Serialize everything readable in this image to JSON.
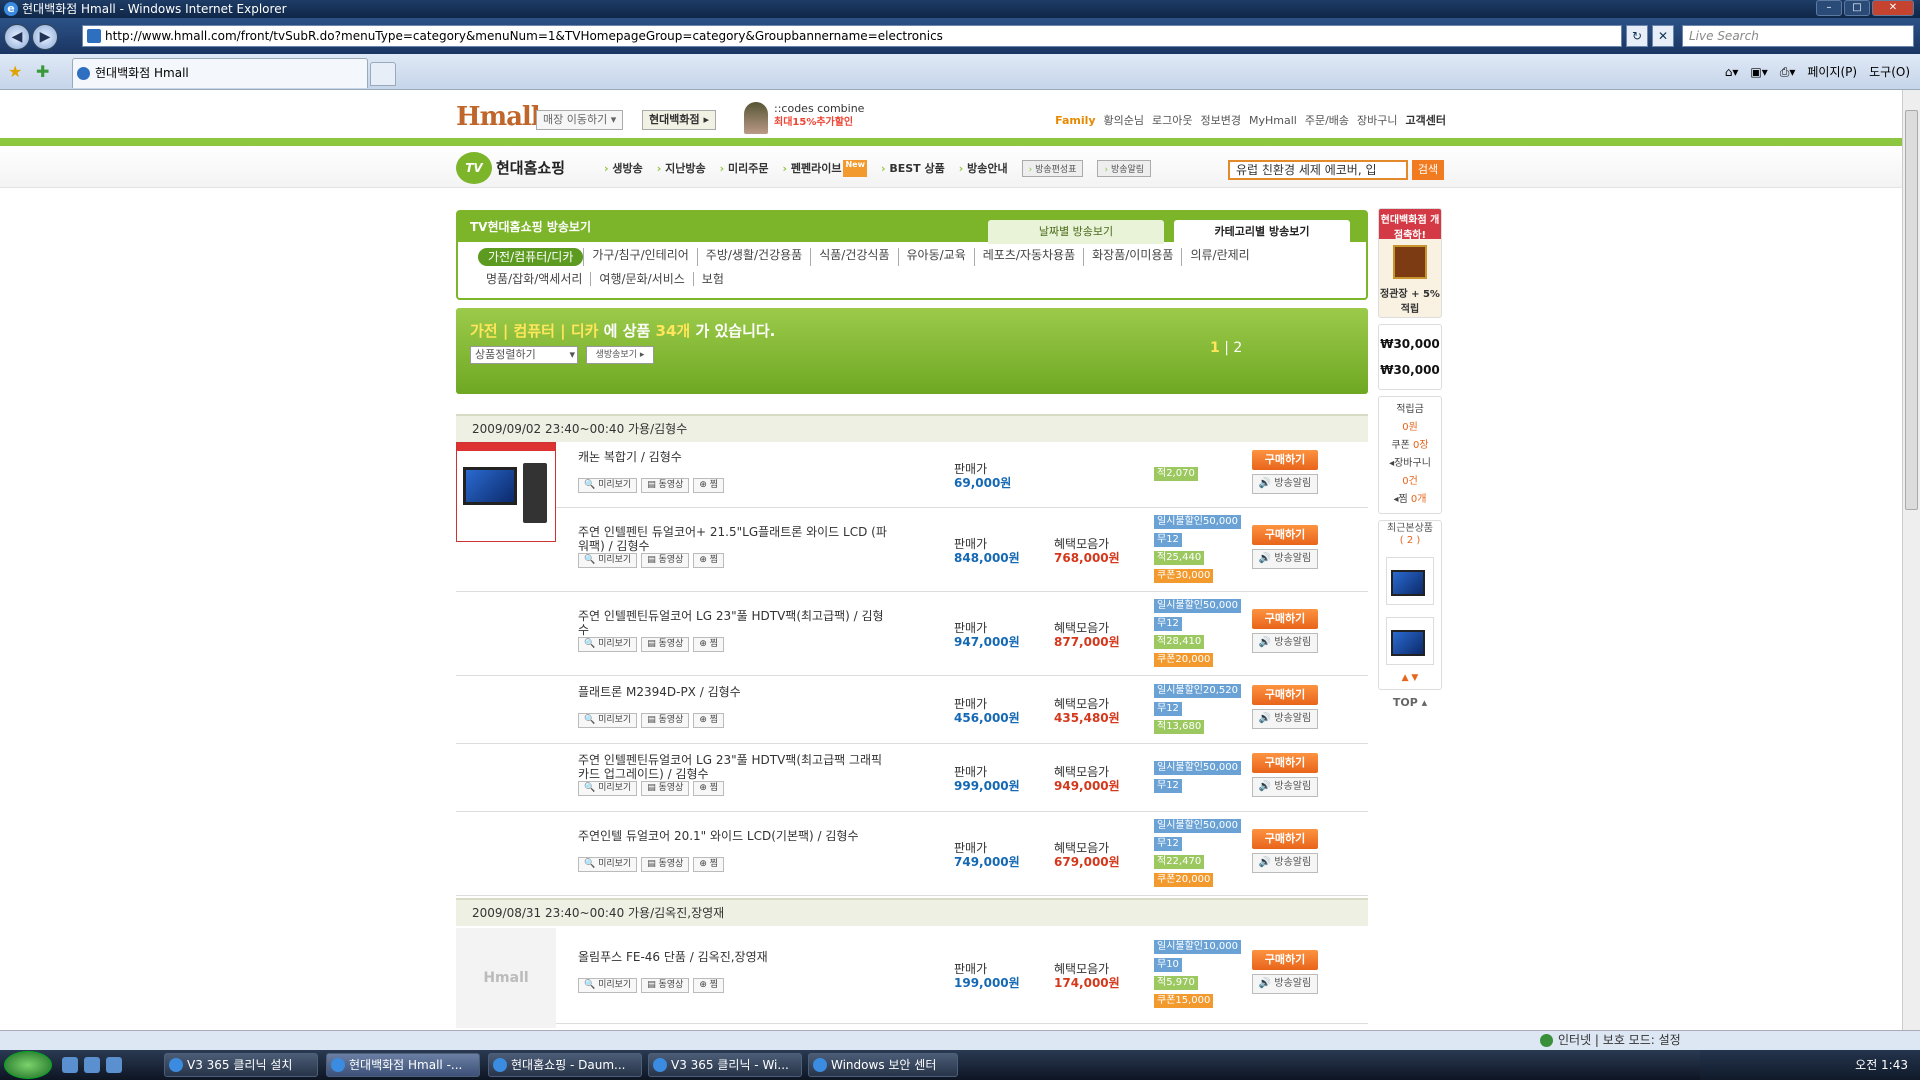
{
  "window": {
    "title": "현대백화점 Hmall - Windows Internet Explorer"
  },
  "browser": {
    "url": "http://www.hmall.com/front/tvSubR.do?menuType=category&menuNum=1&TVHomepageGroup=category&Groupbannername=electronics",
    "search_placeholder": "Live Search",
    "tab_title": "현대백화점 Hmall",
    "cmd_page": "페이지(P)",
    "cmd_tools": "도구(O)"
  },
  "site": {
    "logo": "Hmall",
    "store_select": "매장 이동하기",
    "dept_btn": "현대백화점",
    "codes": "::codes combine",
    "codes_sub": "최대15%추가할인",
    "toplinks": [
      "Family",
      "황의순님",
      "로그아웃",
      "정보변경",
      "MyHmall",
      "주문/배송",
      "장바구니",
      "고객센터"
    ],
    "tv_logo": "현대홈쇼핑",
    "tv_badge": "TV",
    "gnb": [
      "생방송",
      "지난방송",
      "미리주문",
      "펜펜라이브",
      "BEST 상품",
      "방송안내"
    ],
    "gnb_new": "New",
    "gnb_btns": [
      "방송편성표",
      "방송알림"
    ],
    "search_value": "유럽 친환경 세제 에코버, 입",
    "search_btn": "검색"
  },
  "catbox": {
    "title": "TV현대홈쇼핑 방송보기",
    "tab_date": "날짜별 방송보기",
    "tab_cat": "카테고리별 방송보기",
    "cats": [
      "가전/컴퓨터/디카",
      "가구/침구/인테리어",
      "주방/생활/건강용품",
      "식품/건강식품",
      "유아동/교육",
      "레포츠/자동차용품",
      "화장품/이미용품",
      "의류/란제리",
      "명품/잡화/액세서리",
      "여행/문화/서비스",
      "보험"
    ]
  },
  "result": {
    "cat": "가전 | 컴퓨터 | 디카",
    "mid": " 에 상품 ",
    "count": "34개",
    "tail": " 가 있습니다.",
    "sort": "상품정렬하기",
    "livebtn": "생방송보기",
    "page1": "1",
    "page2": "2"
  },
  "labels": {
    "price": "판매가",
    "benefit": "혜택모음가",
    "buy": "구매하기",
    "alarm": "방송알림",
    "preview": "미리보기",
    "video": "동영상",
    "zzim": "찜"
  },
  "groups": [
    {
      "date": "2009/09/02  23:40~00:40 가용/김형수",
      "items": [
        {
          "name": "캐논 복합기 / 김형수",
          "price": "69,000원",
          "benefit": "",
          "badges": [
            {
              "t": "적2,070",
              "c": "b-jeok"
            }
          ]
        },
        {
          "name": "주연 인텔펜틴 듀얼코어+ 21.5\"LG플래트론 와이드 LCD (파워팩) / 김형수",
          "price": "848,000원",
          "benefit": "768,000원",
          "badges": [
            {
              "t": "일시불할인50,000",
              "c": "b-sale"
            },
            {
              "t": "무12",
              "c": "b-mu"
            },
            {
              "t": "적25,440",
              "c": "b-jeok"
            },
            {
              "t": "쿠폰30,000",
              "c": "b-cp"
            }
          ]
        },
        {
          "name": "주연 인텔펜틴듀얼코어 LG 23\"풀 HDTV팩(최고급팩) / 김형수",
          "price": "947,000원",
          "benefit": "877,000원",
          "badges": [
            {
              "t": "일시불할인50,000",
              "c": "b-sale"
            },
            {
              "t": "무12",
              "c": "b-mu"
            },
            {
              "t": "적28,410",
              "c": "b-jeok"
            },
            {
              "t": "쿠폰20,000",
              "c": "b-cp"
            }
          ]
        },
        {
          "name": "플래트론 M2394D-PX / 김형수",
          "price": "456,000원",
          "benefit": "435,480원",
          "badges": [
            {
              "t": "일시불할인20,520",
              "c": "b-sale"
            },
            {
              "t": "무12",
              "c": "b-mu"
            },
            {
              "t": "적13,680",
              "c": "b-jeok"
            }
          ]
        },
        {
          "name": "주연 인텔펜틴듀얼코어 LG 23\"풀 HDTV팩(최고급팩 그래픽카드 업그레이드) / 김형수",
          "price": "999,000원",
          "benefit": "949,000원",
          "badges": [
            {
              "t": "일시불할인50,000",
              "c": "b-sale"
            },
            {
              "t": "무12",
              "c": "b-mu"
            }
          ]
        },
        {
          "name": "주연인텔 듀얼코어 20.1\" 와이드 LCD(기본팩) / 김형수",
          "price": "749,000원",
          "benefit": "679,000원",
          "badges": [
            {
              "t": "일시불할인50,000",
              "c": "b-sale"
            },
            {
              "t": "무12",
              "c": "b-mu"
            },
            {
              "t": "적22,470",
              "c": "b-jeok"
            },
            {
              "t": "쿠폰20,000",
              "c": "b-cp"
            }
          ]
        }
      ]
    },
    {
      "date": "2009/08/31  23:40~00:40 가용/김옥진,장영재",
      "items": [
        {
          "name": "올림푸스 FE-46 단품 / 김옥진,장영재",
          "price": "199,000원",
          "benefit": "174,000원",
          "badges": [
            {
              "t": "일시불할인10,000",
              "c": "b-sale"
            },
            {
              "t": "무10",
              "c": "b-mu"
            },
            {
              "t": "적5,970",
              "c": "b-jeok"
            },
            {
              "t": "쿠폰15,000",
              "c": "b-cp"
            }
          ]
        }
      ]
    }
  ],
  "last_partial_badge": "일시불할인10,000",
  "thumb_gray": "Hmall",
  "side": {
    "banner_top": "현대백화점 개점축하!",
    "banner_sub": "정관장 + 5%적립",
    "money1": "₩30,000",
    "money2": "₩30,000",
    "points_label": "적립금",
    "points": "0원",
    "coupon_label": "쿠폰",
    "coupon": "0장",
    "cart_label": "장바구니",
    "cart": "0건",
    "zzim_label": "찜",
    "zzim": "0개",
    "recent_label": "최근본상품",
    "recent_count": "( 2 )",
    "top": "TOP"
  },
  "status": {
    "zone": "인터넷 | 보호 모드: 설정"
  },
  "taskbar": {
    "items": [
      "V3 365 클리닉 설치",
      "현대백화점 Hmall -...",
      "현대홈쇼핑 - Daum...",
      "V3 365 클리닉 - Wi...",
      "Windows 보안 센터"
    ],
    "clock": "오전 1:43"
  }
}
